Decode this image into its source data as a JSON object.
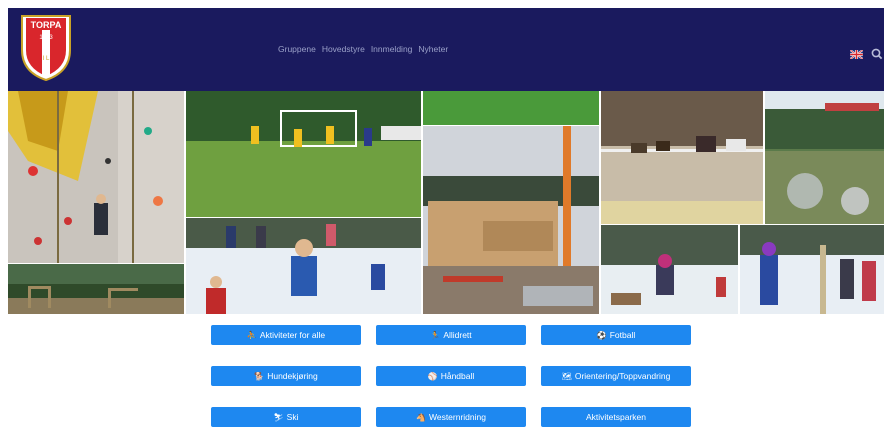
{
  "header": {
    "logo_text": "TORPA",
    "logo_year": "1933",
    "logo_letters": "I L",
    "nav": [
      "Gruppene",
      "Hovedstyre",
      "Innmelding",
      "Nyheter"
    ],
    "language_flag": "uk-flag-icon",
    "search_icon": "search-icon"
  },
  "buttons": [
    {
      "label": "Aktiviteter for alle",
      "icon": "⛹"
    },
    {
      "label": "Allidrett",
      "icon": "🏃"
    },
    {
      "label": "Fotball",
      "icon": "⚽"
    },
    {
      "label": "Hundekjøring",
      "icon": "🐕"
    },
    {
      "label": "Håndball",
      "icon": "⚾"
    },
    {
      "label": "Orientering/Toppvandring",
      "icon": "🗺"
    },
    {
      "label": "Ski",
      "icon": "⛷"
    },
    {
      "label": "Westernridning",
      "icon": "🐴"
    },
    {
      "label": "Aktivitetsparken",
      "icon": ""
    }
  ],
  "colors": {
    "header_bg": "#1a1a5e",
    "button_bg": "#1e88f0",
    "nav_text": "#9aa0c8"
  }
}
